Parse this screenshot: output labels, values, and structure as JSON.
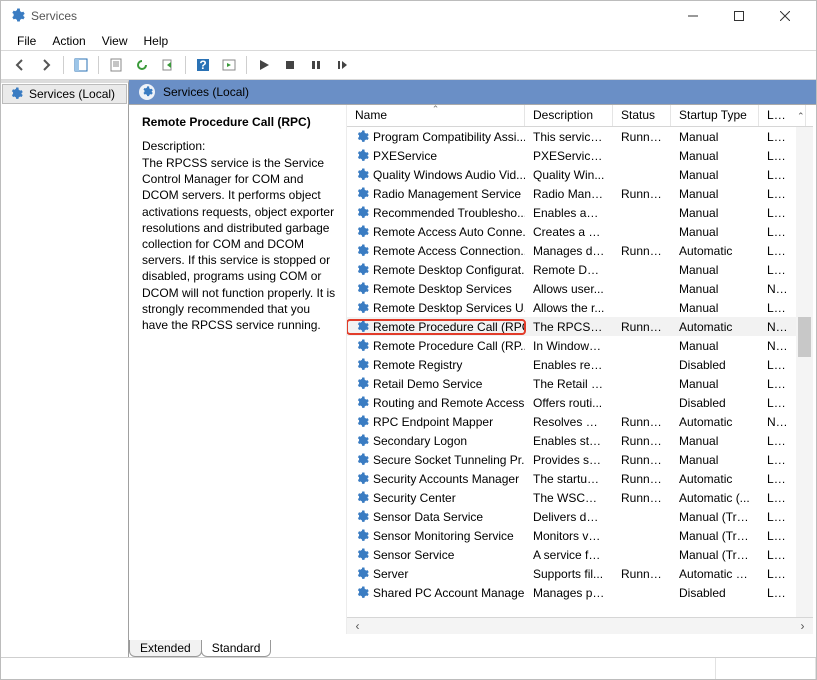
{
  "window": {
    "title": "Services",
    "sys": {
      "min": "Minimize",
      "max": "Restore",
      "close": "Close"
    }
  },
  "menu": [
    "File",
    "Action",
    "View",
    "Help"
  ],
  "left": {
    "header": "Services (Local)"
  },
  "right_header": "Services (Local)",
  "selected": {
    "title": "Remote Procedure Call (RPC)",
    "desc_label": "Description:",
    "desc": "The RPCSS service is the Service Control Manager for COM and DCOM servers. It performs object activations requests, object exporter resolutions and distributed garbage collection for COM and DCOM servers. If this service is stopped or disabled, programs using COM or DCOM will not function properly. It is strongly recommended that you have the RPCSS service running."
  },
  "columns": {
    "name": "Name",
    "desc": "Description",
    "status": "Status",
    "startup": "Startup Type",
    "logon": "Log"
  },
  "services": [
    {
      "name": "Program Compatibility Assi...",
      "desc": "This service ...",
      "status": "Running",
      "startup": "Manual",
      "logon": "Loca"
    },
    {
      "name": "PXEService",
      "desc": "PXEService ...",
      "status": "",
      "startup": "Manual",
      "logon": "Loca"
    },
    {
      "name": "Quality Windows Audio Vid...",
      "desc": "Quality Win...",
      "status": "",
      "startup": "Manual",
      "logon": "Loca"
    },
    {
      "name": "Radio Management Service",
      "desc": "Radio Mana...",
      "status": "Running",
      "startup": "Manual",
      "logon": "Loca"
    },
    {
      "name": "Recommended Troublesho...",
      "desc": "Enables aut...",
      "status": "",
      "startup": "Manual",
      "logon": "Loca"
    },
    {
      "name": "Remote Access Auto Conne...",
      "desc": "Creates a co...",
      "status": "",
      "startup": "Manual",
      "logon": "Loca"
    },
    {
      "name": "Remote Access Connection...",
      "desc": "Manages di...",
      "status": "Running",
      "startup": "Automatic",
      "logon": "Loca"
    },
    {
      "name": "Remote Desktop Configurat...",
      "desc": "Remote Des...",
      "status": "",
      "startup": "Manual",
      "logon": "Loca"
    },
    {
      "name": "Remote Desktop Services",
      "desc": "Allows user...",
      "status": "",
      "startup": "Manual",
      "logon": "Netv"
    },
    {
      "name": "Remote Desktop Services U...",
      "desc": "Allows the r...",
      "status": "",
      "startup": "Manual",
      "logon": "Loca"
    },
    {
      "name": "Remote Procedure Call (RPC)",
      "desc": "The RPCSS s...",
      "status": "Running",
      "startup": "Automatic",
      "logon": "Netv",
      "highlight": true,
      "selected": true
    },
    {
      "name": "Remote Procedure Call (RP...",
      "desc": "In Windows...",
      "status": "",
      "startup": "Manual",
      "logon": "Netv"
    },
    {
      "name": "Remote Registry",
      "desc": "Enables rem...",
      "status": "",
      "startup": "Disabled",
      "logon": "Loca"
    },
    {
      "name": "Retail Demo Service",
      "desc": "The Retail D...",
      "status": "",
      "startup": "Manual",
      "logon": "Loca"
    },
    {
      "name": "Routing and Remote Access",
      "desc": "Offers routi...",
      "status": "",
      "startup": "Disabled",
      "logon": "Loca"
    },
    {
      "name": "RPC Endpoint Mapper",
      "desc": "Resolves RP...",
      "status": "Running",
      "startup": "Automatic",
      "logon": "Netv"
    },
    {
      "name": "Secondary Logon",
      "desc": "Enables star...",
      "status": "Running",
      "startup": "Manual",
      "logon": "Loca"
    },
    {
      "name": "Secure Socket Tunneling Pr...",
      "desc": "Provides su...",
      "status": "Running",
      "startup": "Manual",
      "logon": "Loca"
    },
    {
      "name": "Security Accounts Manager",
      "desc": "The startup ...",
      "status": "Running",
      "startup": "Automatic",
      "logon": "Loca"
    },
    {
      "name": "Security Center",
      "desc": "The WSCSV...",
      "status": "Running",
      "startup": "Automatic (...",
      "logon": "Loca"
    },
    {
      "name": "Sensor Data Service",
      "desc": "Delivers dat...",
      "status": "",
      "startup": "Manual (Trig...",
      "logon": "Loca"
    },
    {
      "name": "Sensor Monitoring Service",
      "desc": "Monitors va...",
      "status": "",
      "startup": "Manual (Trig...",
      "logon": "Loca"
    },
    {
      "name": "Sensor Service",
      "desc": "A service fo...",
      "status": "",
      "startup": "Manual (Trig...",
      "logon": "Loca"
    },
    {
      "name": "Server",
      "desc": "Supports fil...",
      "status": "Running",
      "startup": "Automatic (T...",
      "logon": "Loca"
    },
    {
      "name": "Shared PC Account Manager",
      "desc": "Manages pr...",
      "status": "",
      "startup": "Disabled",
      "logon": "Loca"
    }
  ],
  "tabs": {
    "extended": "Extended",
    "standard": "Standard"
  }
}
